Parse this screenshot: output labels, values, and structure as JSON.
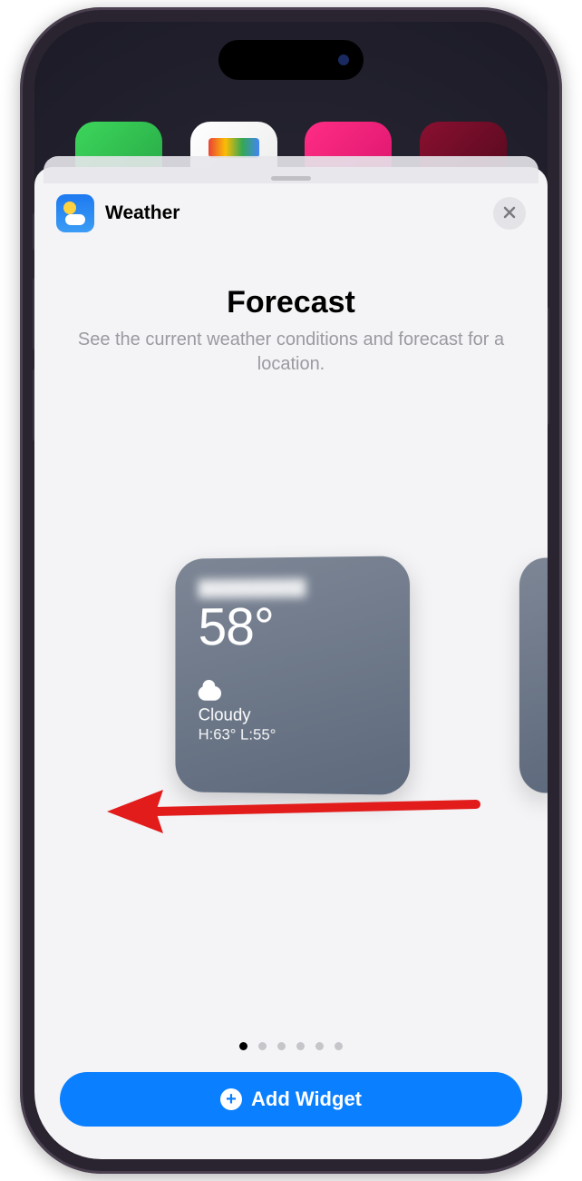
{
  "app": {
    "name": "Weather"
  },
  "sheet": {
    "title": "Forecast",
    "subtitle": "See the current weather conditions and forecast for a location."
  },
  "widget": {
    "location": "██████████",
    "temperature": "58°",
    "condition": "Cloudy",
    "range": "H:63° L:55°"
  },
  "pager": {
    "count": 6,
    "active_index": 0
  },
  "actions": {
    "add_widget": "Add Widget"
  },
  "annotation": {
    "swipe_hint": "swipe-left"
  }
}
